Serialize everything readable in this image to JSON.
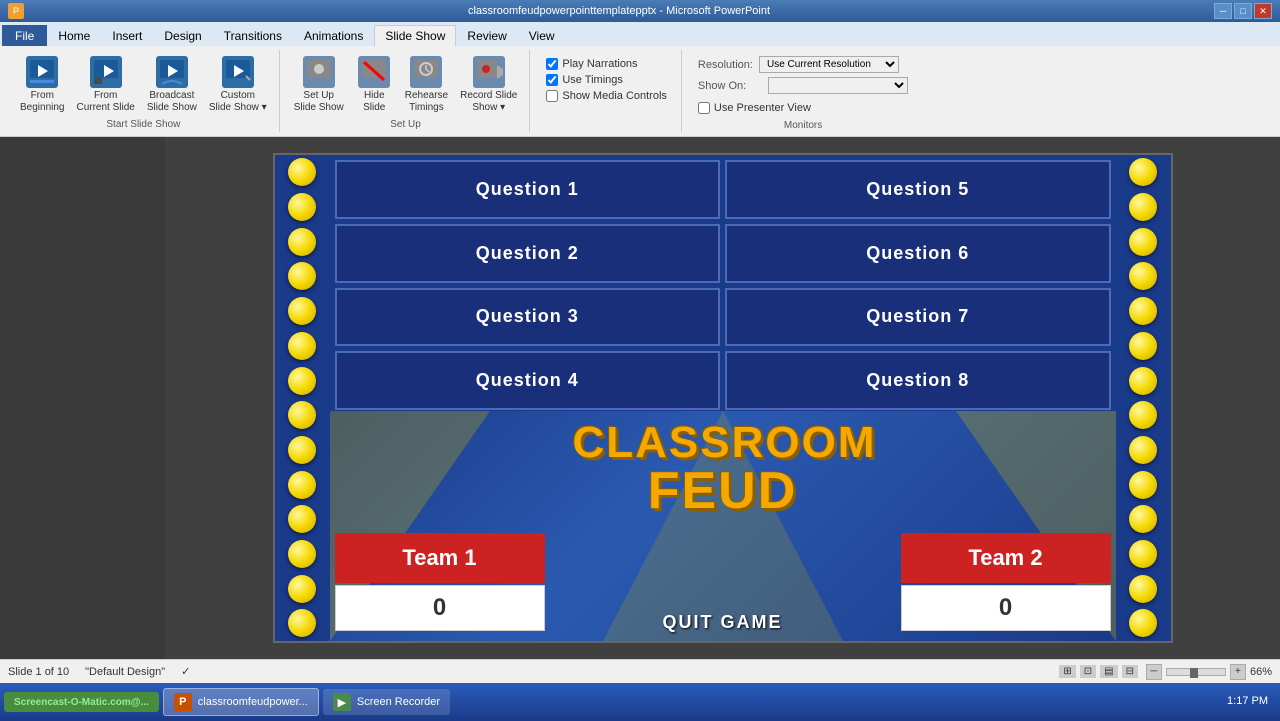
{
  "titleBar": {
    "title": "classroomfeudpowerpointtemplatepptx - Microsoft PowerPoint",
    "controls": [
      "─",
      "□",
      "✕"
    ]
  },
  "ribbon": {
    "tabs": [
      "File",
      "Home",
      "Insert",
      "Design",
      "Transitions",
      "Animations",
      "Slide Show",
      "Review",
      "View"
    ],
    "activeTab": "Slide Show",
    "groups": {
      "startSlideShow": {
        "label": "Start Slide Show",
        "buttons": [
          {
            "label": "From\nBeginning",
            "icon": "▶"
          },
          {
            "label": "From\nCurrent Slide",
            "icon": "▶"
          },
          {
            "label": "Broadcast\nSlide Show",
            "icon": "📡"
          },
          {
            "label": "Custom\nSlide Show",
            "icon": "▶"
          }
        ]
      },
      "setup": {
        "label": "Set Up",
        "buttons": [
          {
            "label": "Set Up\nSlide Show",
            "icon": "⚙"
          },
          {
            "label": "Hide\nSlide",
            "icon": "👁"
          },
          {
            "label": "Rehearse\nTimings",
            "icon": "⏱"
          },
          {
            "label": "Record Slide\nShow",
            "icon": "⏺"
          }
        ]
      },
      "checks": [
        {
          "label": "Play Narrations",
          "checked": true
        },
        {
          "label": "Use Timings",
          "checked": true
        },
        {
          "label": "Show Media Controls",
          "checked": false
        }
      ],
      "monitors": {
        "label": "Monitors",
        "resolution": "Use Current Resolution",
        "showOn": "",
        "presenterView": false
      }
    }
  },
  "slide": {
    "questions": [
      "Question 1",
      "Question 5",
      "Question 2",
      "Question 6",
      "Question 3",
      "Question 7",
      "Question 4",
      "Question 8"
    ],
    "title1": "CLASSROOM",
    "title2": "FEUD",
    "team1": {
      "label": "Team 1",
      "score": "0"
    },
    "team2": {
      "label": "Team 2",
      "score": "0"
    },
    "quitLabel": "QUIT GAME"
  },
  "statusBar": {
    "slideInfo": "Slide 1 of 10",
    "theme": "\"Default Design\"",
    "zoomLevel": "66%"
  },
  "taskbar": {
    "startLabel": "Screencast-O-Matic.com@...",
    "items": [
      {
        "label": "classroomfeudpower...",
        "icon": "P",
        "active": true
      },
      {
        "label": "Screen Recorder",
        "icon": "📹",
        "active": false
      }
    ],
    "clock": "1:17 PM"
  }
}
